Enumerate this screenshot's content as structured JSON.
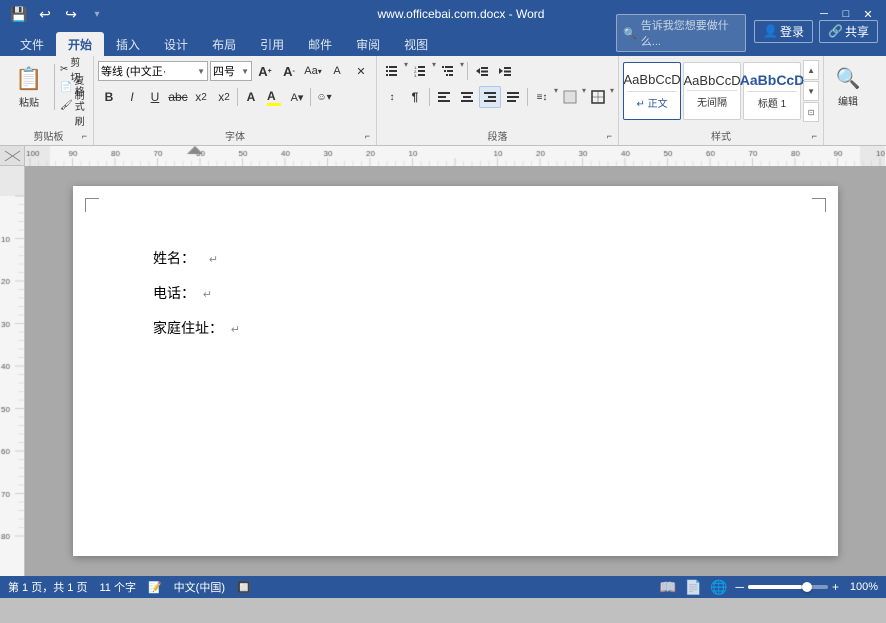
{
  "titleBar": {
    "title": "www.officebai.com.docx - Word",
    "quickAccess": [
      "💾",
      "↩",
      "↪"
    ],
    "controls": [
      "─",
      "□",
      "✕"
    ]
  },
  "ribbonTabs": {
    "tabs": [
      "文件",
      "开始",
      "插入",
      "设计",
      "布局",
      "引用",
      "邮件",
      "审阅",
      "视图"
    ],
    "activeTab": "开始",
    "searchPlaceholder": "告诉我您想要做什么...",
    "userButtons": [
      "登录",
      "共享"
    ]
  },
  "ribbon": {
    "groups": [
      {
        "name": "剪贴板",
        "items": [
          "粘贴",
          "剪切",
          "复制",
          "格式刷"
        ]
      },
      {
        "name": "字体",
        "fontName": "等线 (中文正·",
        "fontSize": "四号",
        "items": [
          "A+",
          "A-",
          "Aa▾",
          "A",
          "清除",
          "B",
          "I",
          "U",
          "abc",
          "x₂",
          "x²",
          "A▾",
          "A▾",
          "A▾",
          "☺▾"
        ]
      },
      {
        "name": "段落",
        "items": [
          "≡",
          "≡",
          "≡",
          "≡",
          "≡",
          "↑",
          "↓"
        ]
      },
      {
        "name": "样式",
        "styles": [
          {
            "label": "正文",
            "type": "normal"
          },
          {
            "label": "无间隔",
            "type": "compact"
          },
          {
            "label": "标题 1",
            "type": "h1"
          }
        ]
      },
      {
        "name": "编辑",
        "items": [
          "编辑"
        ]
      }
    ]
  },
  "document": {
    "fields": [
      {
        "label": "姓名：",
        "returnSymbol": "↵"
      },
      {
        "label": "电话：",
        "returnSymbol": "↵"
      },
      {
        "label": "家庭住址：",
        "returnSymbol": "↵"
      }
    ]
  },
  "statusBar": {
    "pageInfo": "第 1 页，共 1 页",
    "wordCount": "11 个字",
    "proofing": "中文(中国)",
    "zoomLevel": "100%",
    "zoomMinus": "─",
    "zoomPlus": "+"
  }
}
